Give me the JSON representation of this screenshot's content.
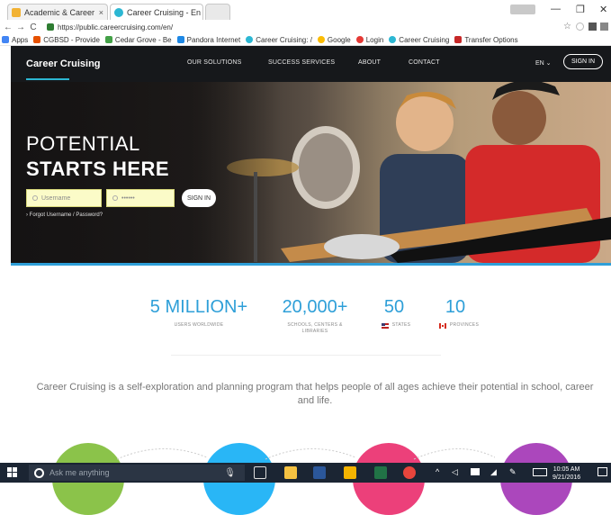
{
  "browser": {
    "tabs": [
      {
        "label": "Academic & Career",
        "color": "#f2b233"
      },
      {
        "label": "Career Cruising - En",
        "color": "#2cb7d3"
      }
    ],
    "url": "https://public.careercruising.com/en/",
    "bookmarks": [
      {
        "label": "Apps",
        "color": "#4285f4"
      },
      {
        "label": "CGBSD - Provide",
        "color": "#e65100"
      },
      {
        "label": "Cedar Grove - Be",
        "color": "#43a047"
      },
      {
        "label": "Pandora Internet",
        "color": "#1e88e5"
      },
      {
        "label": "Career Cruising: /",
        "color": "#2cb7d3"
      },
      {
        "label": "Google",
        "color": "#fbbc05"
      },
      {
        "label": "Login",
        "color": "#e53935"
      },
      {
        "label": "Career Cruising",
        "color": "#2cb7d3"
      },
      {
        "label": "Transfer Options",
        "color": "#c62828"
      }
    ]
  },
  "site": {
    "logo": "Career Cruising",
    "nav": [
      "OUR SOLUTIONS",
      "SUCCESS SERVICES",
      "ABOUT",
      "CONTACT"
    ],
    "lang": "EN ⌄",
    "signin": "SIGN IN"
  },
  "hero": {
    "title_line1": "POTENTIAL",
    "title_line2": "STARTS HERE",
    "username_placeholder": "Username",
    "password_value": "••••••",
    "signin": "SIGN IN",
    "forgot": "›  Forgot Username / Password?"
  },
  "stats": [
    {
      "number": "5 MILLION+",
      "label": "USERS WORLDWIDE"
    },
    {
      "number": "20,000+",
      "label": "SCHOOLS, CENTERS & LIBRARIES"
    },
    {
      "number": "50",
      "label": "STATES"
    },
    {
      "number": "10",
      "label": "PROVINCES"
    }
  ],
  "description": "Career Cruising is a self-exploration and planning program that helps people of all ages achieve their potential in school, career and life.",
  "colors": {
    "accent": "#2e9fd8",
    "circles": [
      "#8bc34a",
      "#29b6f6",
      "#ec407a",
      "#ab47bc"
    ]
  },
  "taskbar": {
    "search": "Ask me anything",
    "time": "10:05 AM",
    "date": "9/21/2016"
  }
}
